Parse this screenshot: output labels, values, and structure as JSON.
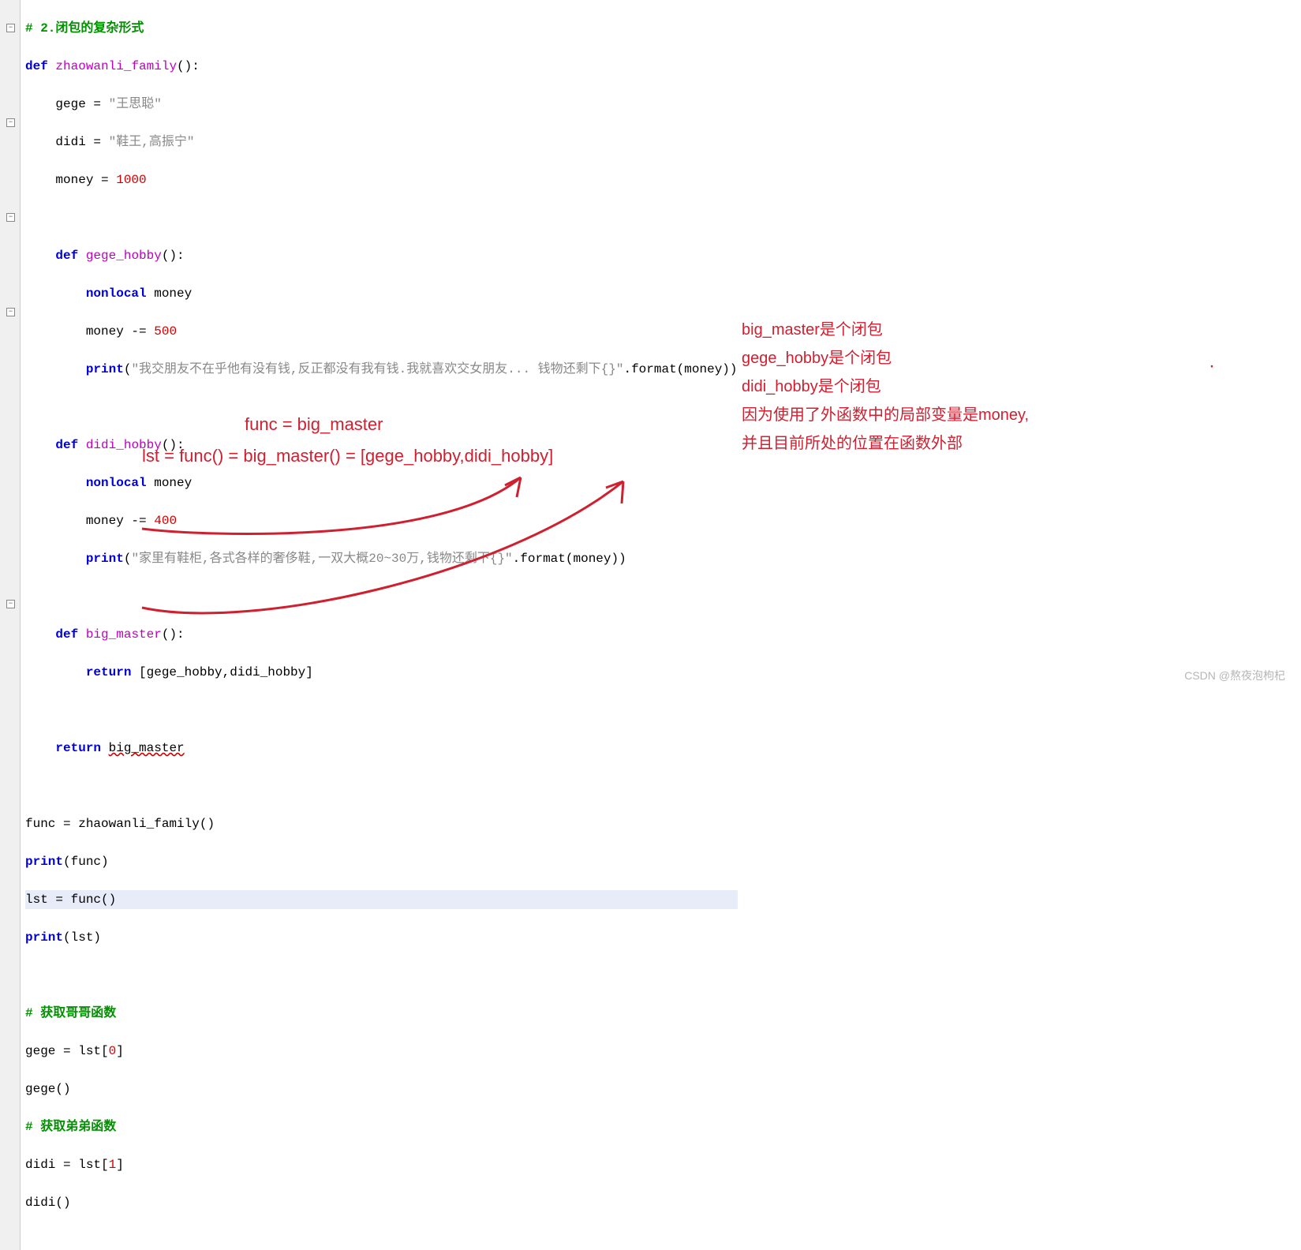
{
  "code": {
    "l0": "# 2.闭包的复杂形式",
    "l1_def": "def",
    "l1_fn": "zhaowanli_family",
    "l1_rest": "():",
    "l2a": "    gege = ",
    "l2b": "\"王思聪\"",
    "l3a": "    didi = ",
    "l3b": "\"鞋王,高振宁\"",
    "l4a": "    money = ",
    "l4b": "1000",
    "l6_def": "def",
    "l6_fn": "gege_hobby",
    "l6_rest": "():",
    "l7a": "        ",
    "l7b": "nonlocal",
    "l7c": " money",
    "l8a": "        money -= ",
    "l8b": "500",
    "l9a": "        ",
    "l9b": "print",
    "l9c": "(",
    "l9d": "\"我交朋友不在乎他有没有钱,反正都没有我有钱.我就喜欢交女朋友... 钱物还剩下{}\"",
    "l9e": ".format(money))",
    "l11_def": "def",
    "l11_fn": "didi_hobby",
    "l11_rest": "():",
    "l12a": "        ",
    "l12b": "nonlocal",
    "l12c": " money",
    "l13a": "        money -= ",
    "l13b": "400",
    "l14a": "        ",
    "l14b": "print",
    "l14c": "(",
    "l14d": "\"家里有鞋柜,各式各样的奢侈鞋,一双大概20~30万,钱物还剩下{}\"",
    "l14e": ".format(money))",
    "l16_def": "def",
    "l16_fn": "big_master",
    "l16_rest": "():",
    "l17a": "        ",
    "l17b": "return",
    "l17c": " [gege_hobby,didi_hobby]",
    "l19a": "    ",
    "l19b": "return",
    "l19c": " ",
    "l19d": "big_master",
    "l21": "func = zhaowanli_family()",
    "l22a": "print",
    "l22b": "(func)",
    "l23": "lst = func()",
    "l24a": "print",
    "l24b": "(lst)",
    "l26": "# 获取哥哥函数",
    "l27a": "gege = lst[",
    "l27b": "0",
    "l27c": "]",
    "l28": "gege()",
    "l29": "# 获取弟弟函数",
    "l30a": "didi = lst[",
    "l30b": "1",
    "l30c": "]",
    "l31": "didi()"
  },
  "annotations": {
    "right1": "big_master是个闭包",
    "right2": "gege_hobby是个闭包",
    "right3": "didi_hobby是个闭包",
    "right4": "因为使用了外函数中的局部变量是money,",
    "right5": "并且目前所处的位置在函数外部",
    "func": "func = big_master",
    "lst": "lst = func() = big_master() = [gege_hobby,didi_hobby]"
  },
  "watermark": "CSDN @熬夜泡枸杞"
}
